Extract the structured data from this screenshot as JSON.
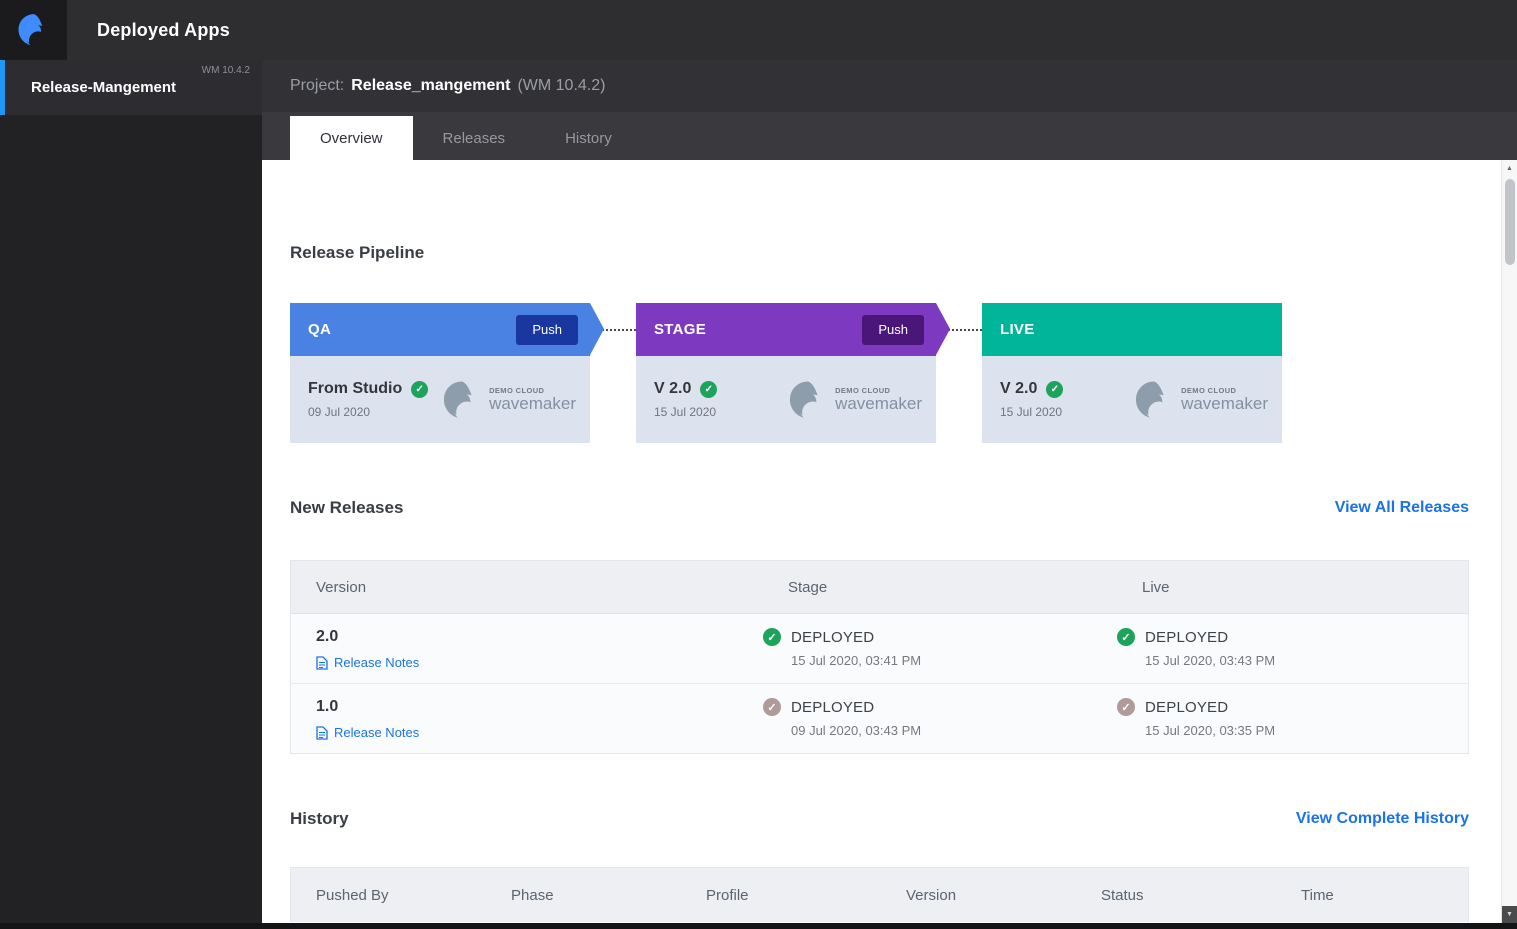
{
  "topbar": {
    "title": "Deployed Apps"
  },
  "sidebar": {
    "items": [
      {
        "label": "Release-Mangement",
        "version": "WM 10.4.2",
        "selected": true
      }
    ]
  },
  "project_header": {
    "label": "Project:",
    "name": "Release_mangement",
    "version": "(WM 10.4.2)"
  },
  "tabs": [
    {
      "label": "Overview",
      "active": true
    },
    {
      "label": "Releases",
      "active": false
    },
    {
      "label": "History",
      "active": false
    }
  ],
  "pipeline": {
    "heading": "Release Pipeline",
    "logo": {
      "top": "DEMO CLOUD",
      "bottom": "wavemaker"
    },
    "stages": [
      {
        "name": "QA",
        "action": "Push",
        "version": "From Studio",
        "date": "09 Jul 2020",
        "header_color": "#4a82e4",
        "action_color": "#19379f"
      },
      {
        "name": "STAGE",
        "action": "Push",
        "version": "V 2.0",
        "date": "15 Jul 2020",
        "header_color": "#7d3ac1",
        "action_color": "#4a1679"
      },
      {
        "name": "LIVE",
        "version": "V 2.0",
        "date": "15 Jul 2020",
        "header_color": "#00b59a"
      }
    ]
  },
  "new_releases": {
    "heading": "New Releases",
    "view_link": "View All Releases",
    "columns": [
      "Version",
      "Stage",
      "Live"
    ],
    "rows": [
      {
        "version": "2.0",
        "notes_link": "Release Notes",
        "stage": {
          "status": "DEPLOYED",
          "time": "15 Jul 2020, 03:41 PM",
          "check": "green"
        },
        "live": {
          "status": "DEPLOYED",
          "time": "15 Jul 2020, 03:43 PM",
          "check": "green"
        }
      },
      {
        "version": "1.0",
        "notes_link": "Release Notes",
        "stage": {
          "status": "DEPLOYED",
          "time": "09 Jul 2020, 03:43 PM",
          "check": "mauve"
        },
        "live": {
          "status": "DEPLOYED",
          "time": "15 Jul 2020, 03:35 PM",
          "check": "mauve"
        }
      }
    ]
  },
  "history": {
    "heading": "History",
    "view_link": "View Complete History",
    "columns": [
      "Pushed By",
      "Phase",
      "Profile",
      "Version",
      "Status",
      "Time"
    ]
  },
  "icons": {
    "check": "✓",
    "scroll_up": "▲",
    "scroll_down": "▼"
  },
  "colors": {
    "link": "#1a73e8",
    "check_green": "#1ea35b",
    "check_mauve": "#b19a9a",
    "qa_header": "#4a82e4",
    "stage_header": "#7d3ac1",
    "live_header": "#00b59a",
    "card_body": "#dde3ee",
    "sidebar_accent": "#2196f3"
  }
}
